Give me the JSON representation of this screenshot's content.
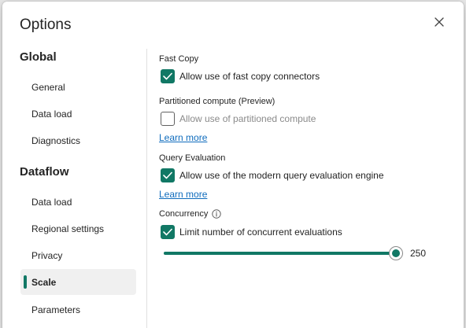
{
  "dialog": {
    "title": "Options",
    "close_icon": "close-icon"
  },
  "sidebar": {
    "global_heading": "Global",
    "global_items": [
      {
        "label": "General"
      },
      {
        "label": "Data load"
      },
      {
        "label": "Diagnostics"
      }
    ],
    "dataflow_heading": "Dataflow",
    "dataflow_items": [
      {
        "label": "Data load"
      },
      {
        "label": "Regional settings"
      },
      {
        "label": "Privacy"
      },
      {
        "label": "Scale",
        "selected": true
      },
      {
        "label": "Parameters"
      }
    ]
  },
  "content": {
    "fast_copy": {
      "label": "Fast Copy",
      "checkbox_label": "Allow use of fast copy connectors",
      "checked": true
    },
    "partitioned_compute": {
      "label": "Partitioned compute (Preview)",
      "checkbox_label": "Allow use of partitioned compute",
      "checked": false,
      "disabled": true,
      "learn_more": "Learn more"
    },
    "query_evaluation": {
      "label": "Query Evaluation",
      "checkbox_label": "Allow use of the modern query evaluation engine",
      "checked": true,
      "learn_more": "Learn more"
    },
    "concurrency": {
      "label": "Concurrency",
      "info_icon": "info-icon",
      "checkbox_label": "Limit number of concurrent evaluations",
      "checked": true,
      "slider_value": "250",
      "slider_fraction": 1.0
    }
  },
  "colors": {
    "accent": "#117865",
    "link": "#0f6cbd"
  }
}
